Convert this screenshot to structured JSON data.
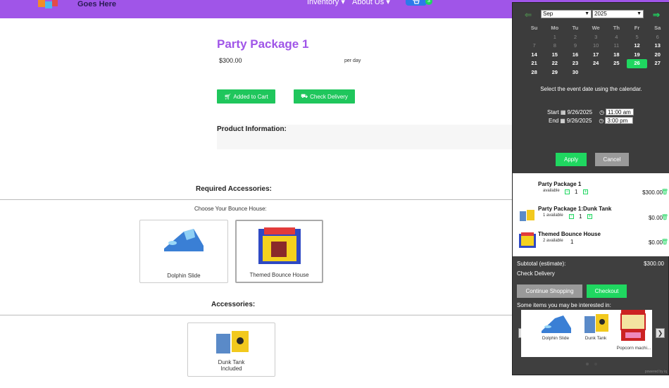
{
  "header": {
    "logo_text": "Goes Here",
    "nav": [
      "Inventory",
      "About Us"
    ],
    "cart_count": "3"
  },
  "product": {
    "title": "Party Package 1",
    "price": "$300.00",
    "per_day": "per day",
    "added_label": "Added to Cart",
    "delivery_label": "Check Delivery",
    "info_label": "Product Information:"
  },
  "required": {
    "heading": "Required Accessories:",
    "choose_label": "Choose Your Bounce House:",
    "options": [
      "Dolphin Slide",
      "Themed Bounce House"
    ]
  },
  "accessories": {
    "heading": "Accessories:",
    "items": [
      {
        "name": "Dunk Tank",
        "status": "Included"
      }
    ]
  },
  "calendar": {
    "month": "Sep",
    "year": "2025",
    "days_of_week": [
      "Su",
      "Mo",
      "Tu",
      "We",
      "Th",
      "Fr",
      "Sa"
    ],
    "weeks": [
      [
        "",
        "1",
        "2",
        "3",
        "4",
        "5",
        "6"
      ],
      [
        "7",
        "8",
        "9",
        "10",
        "11",
        "12",
        "13"
      ],
      [
        "14",
        "15",
        "16",
        "17",
        "18",
        "19",
        "20"
      ],
      [
        "21",
        "22",
        "23",
        "24",
        "25",
        "26",
        "27"
      ],
      [
        "28",
        "29",
        "30",
        "",
        "",
        "",
        ""
      ]
    ],
    "today": "26",
    "message": "Select the event date using the calendar.",
    "start_label": "Start",
    "end_label": "End",
    "start_date": "9/26/2025",
    "end_date": "9/26/2025",
    "start_time": "11:00 am",
    "end_time": "3:00 pm",
    "apply_label": "Apply",
    "cancel_label": "Cancel"
  },
  "cart": {
    "items": [
      {
        "name": "Party Package 1",
        "avail": "available",
        "qty": "1",
        "price": "$300.00"
      },
      {
        "name": "Party Package 1:Dunk Tank",
        "avail": "1 available",
        "qty": "1",
        "price": "$0.00"
      },
      {
        "name": "Themed Bounce House",
        "avail": "2 available",
        "qty": "1",
        "price": "$0.00"
      }
    ],
    "subtotal_label": "Subtotal (estimate):",
    "subtotal_value": "$300.00",
    "check_delivery": "Check Delivery",
    "continue_label": "Continue Shopping",
    "checkout_label": "Checkout",
    "recs_label": "Some items you may be interested in:",
    "recs": [
      "Dolphin Slide",
      "Dunk Tank",
      "Popcorn machi..."
    ],
    "powered": "powered by iq"
  },
  "colors": {
    "brand_purple": "#a055e8",
    "accent_green": "#1fd760",
    "button_green": "#1fc65c",
    "panel_dark": "#3f3f3f"
  }
}
